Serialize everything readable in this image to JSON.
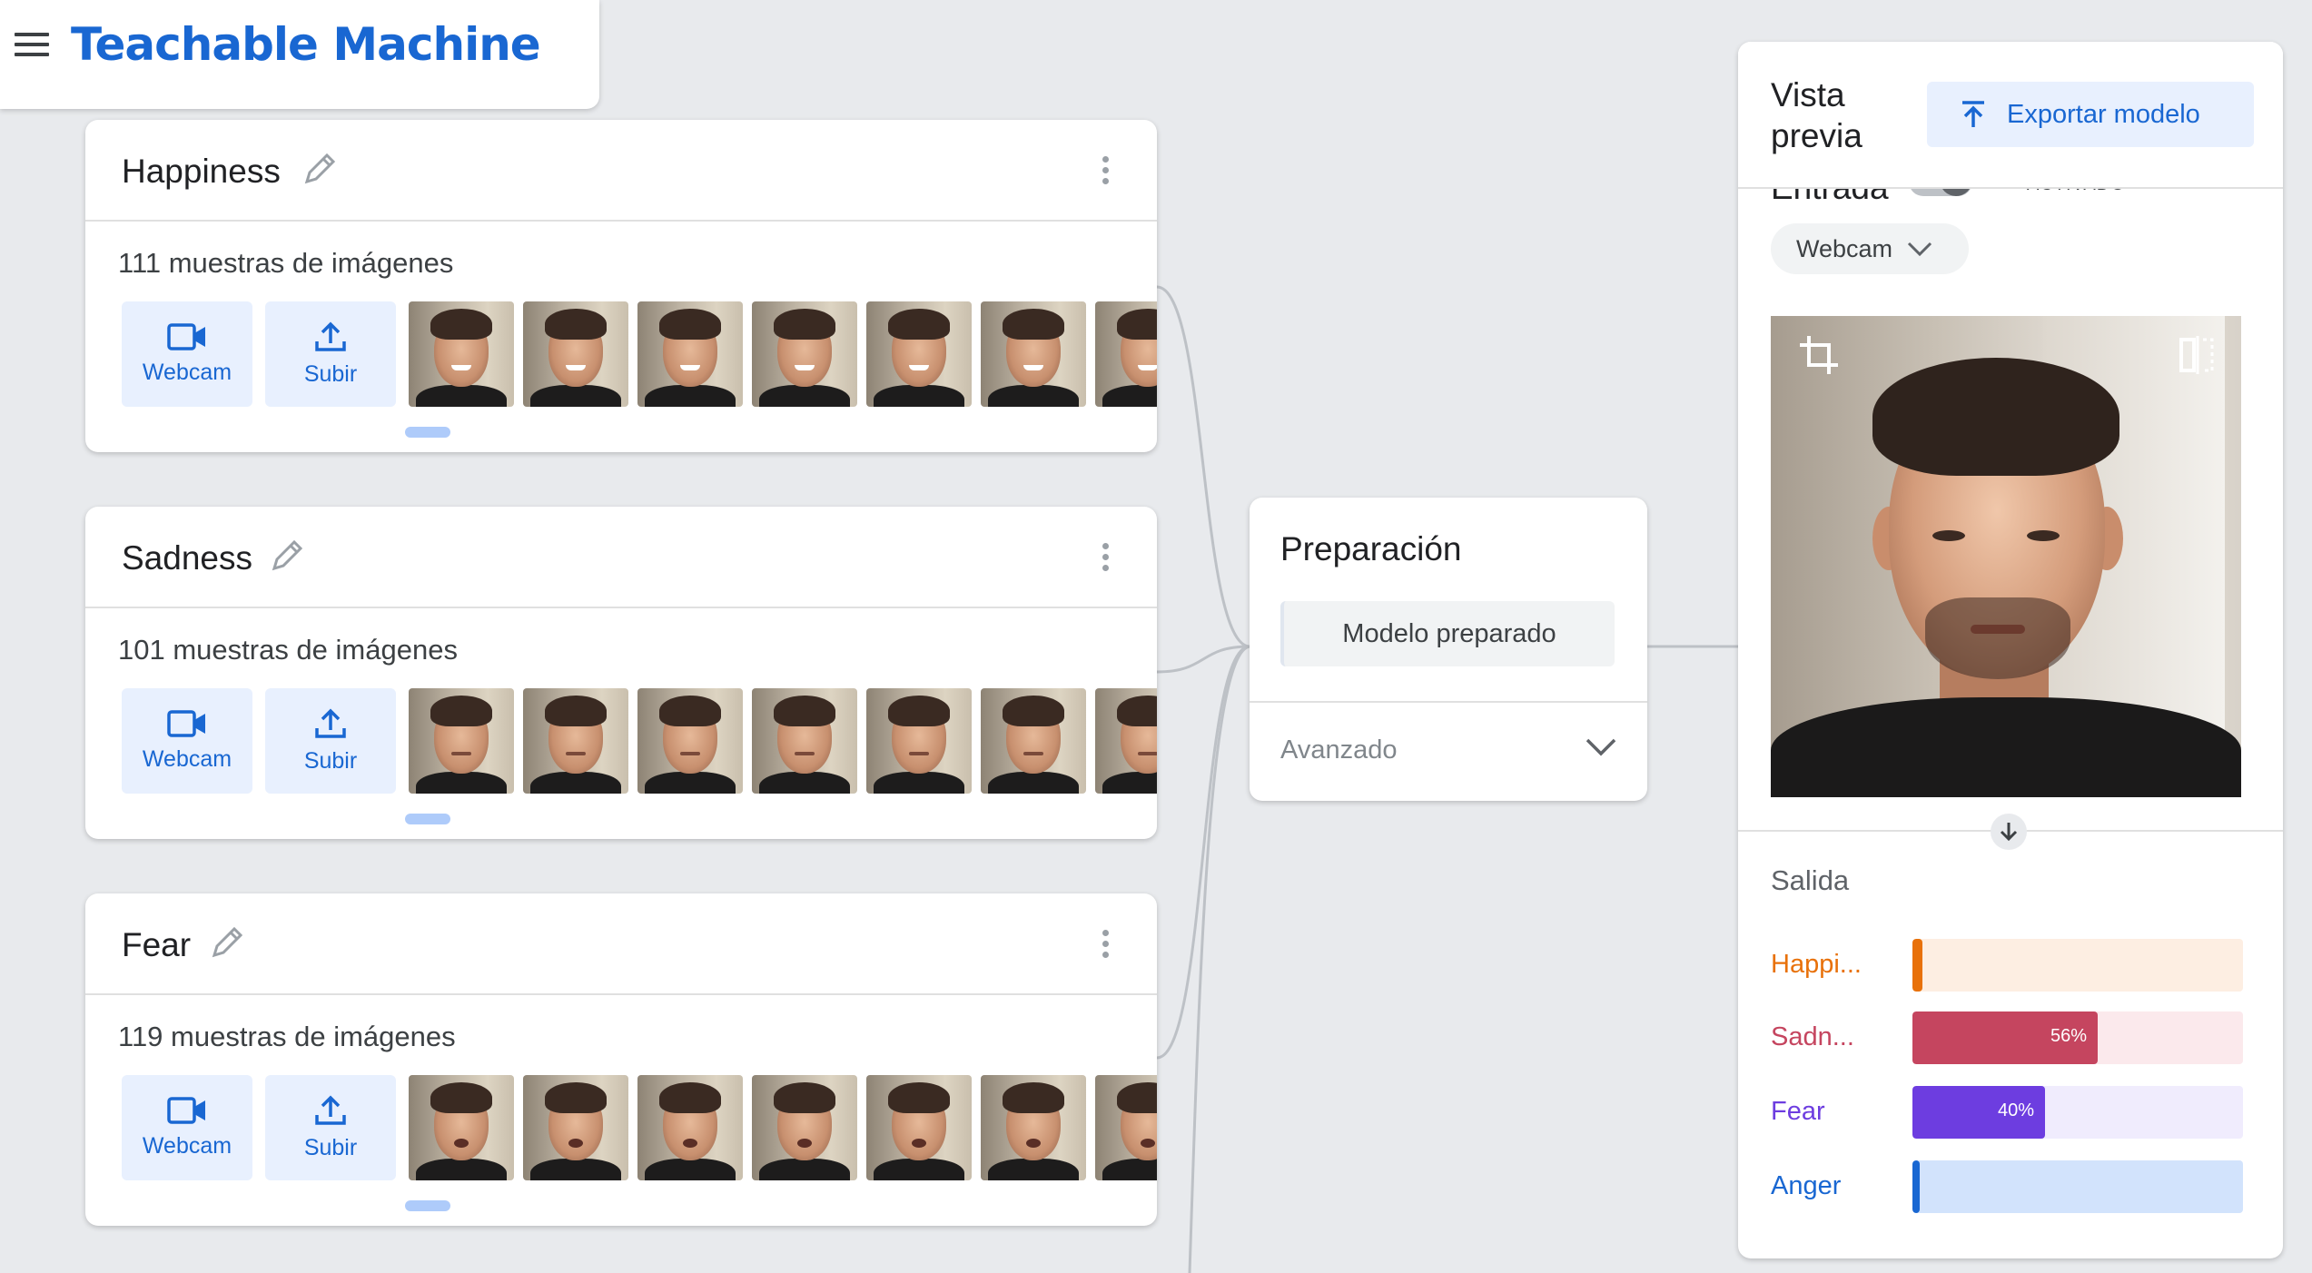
{
  "app": {
    "title": "Teachable Machine"
  },
  "classes": [
    {
      "name": "Happiness",
      "samples": "111 muestras de imágenes",
      "webcam_label": "Webcam",
      "upload_label": "Subir",
      "expression": "happy"
    },
    {
      "name": "Sadness",
      "samples": "101 muestras de imágenes",
      "webcam_label": "Webcam",
      "upload_label": "Subir",
      "expression": "sad"
    },
    {
      "name": "Fear",
      "samples": "119 muestras de imágenes",
      "webcam_label": "Webcam",
      "upload_label": "Subir",
      "expression": "fear"
    }
  ],
  "training": {
    "title": "Preparación",
    "button_label": "Modelo preparado",
    "advanced_label": "Avanzado"
  },
  "preview": {
    "title_line1": "Vista",
    "title_line2": "previa",
    "export_label": "Exportar modelo",
    "input_label": "Entrada",
    "toggle_label": "ACTIVADO",
    "source_select": "Webcam",
    "output_label": "Salida",
    "outputs": [
      {
        "label": "Happi...",
        "percent": 3,
        "pct_text": "",
        "color": "#e8710a",
        "track": "#fdeee2"
      },
      {
        "label": "Sadn...",
        "percent": 56,
        "pct_text": "56%",
        "color": "#c5455f",
        "track": "#fbe9ec"
      },
      {
        "label": "Fear",
        "percent": 40,
        "pct_text": "40%",
        "color": "#6d3de0",
        "track": "#f0ecfd"
      },
      {
        "label": "Anger",
        "percent": 1,
        "pct_text": "",
        "color": "#1967d2",
        "track": "#d2e3fc"
      }
    ]
  },
  "colors": {
    "accent": "#1967d2",
    "tile_bg": "#e8f0fe",
    "background": "#e8eaed"
  },
  "icons": [
    "menu-icon",
    "pencil-icon",
    "kebab-icon",
    "video-camera-icon",
    "upload-icon",
    "chevron-down-icon",
    "export-icon",
    "crop-icon",
    "flip-icon",
    "arrow-down-icon"
  ]
}
